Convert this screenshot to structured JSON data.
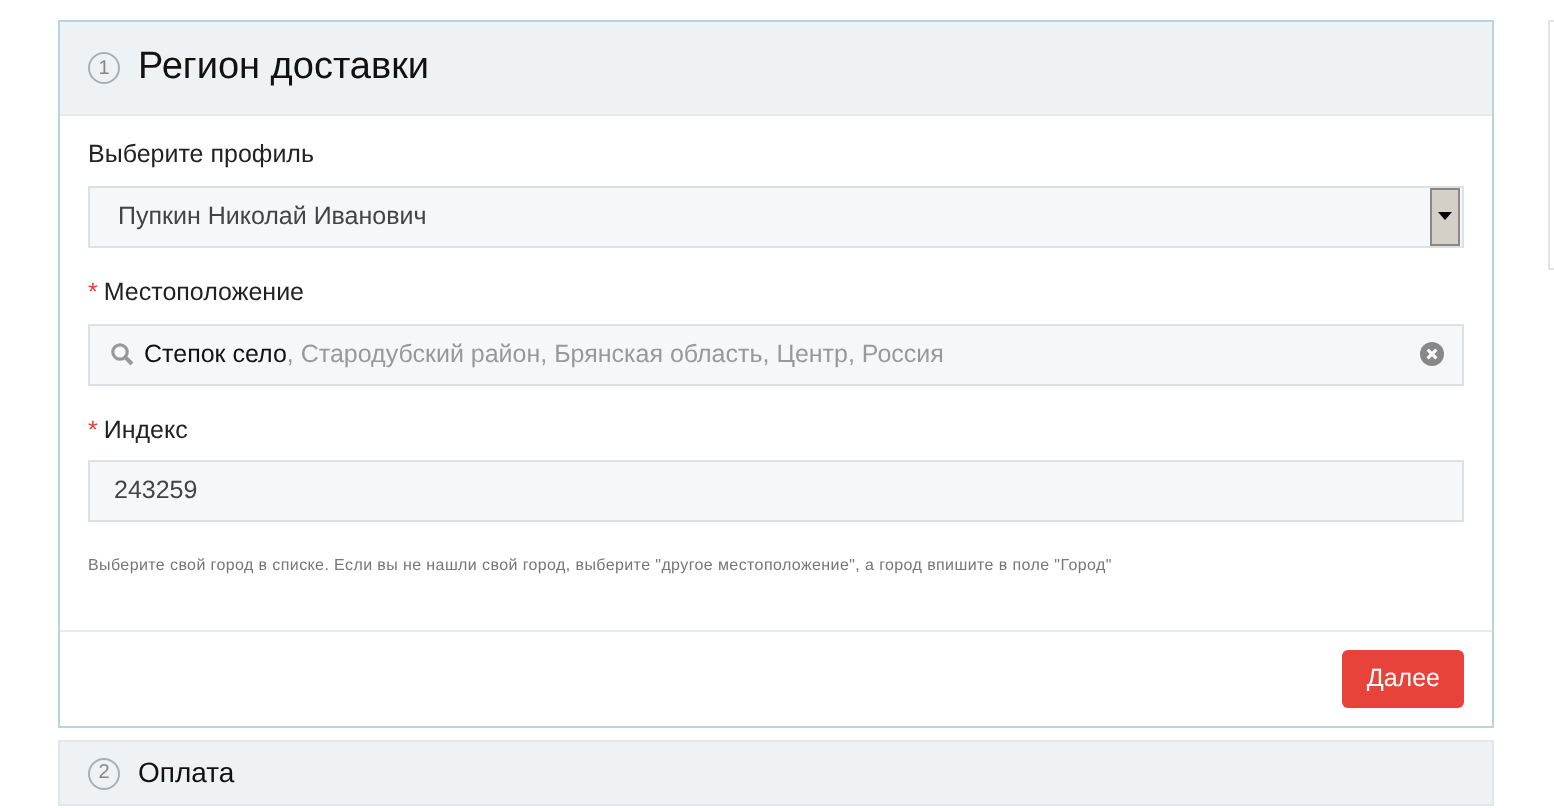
{
  "steps": [
    {
      "number": "1",
      "title": "Регион доставки",
      "expanded": true,
      "fields": [
        {
          "kind": "select",
          "label": "Выберите профиль",
          "value": "Пупкин Николай Иванович"
        },
        {
          "kind": "location",
          "label": "Местоположение",
          "marker": "*",
          "value": "**Степок село**, Стародубский район, Брянская область, Центр, Россия"
        },
        {
          "kind": "text",
          "label": "Индекс",
          "marker": "*",
          "value": "243259"
        }
      ],
      "hint": "Выберите свой город в списке. Если вы не нашли свой город, выберите \"другое местоположение\", а город впишите в поле \"Город\"",
      "button": "Далее"
    },
    {
      "number": "2",
      "title": "Оплата",
      "expanded": false
    }
  ]
}
